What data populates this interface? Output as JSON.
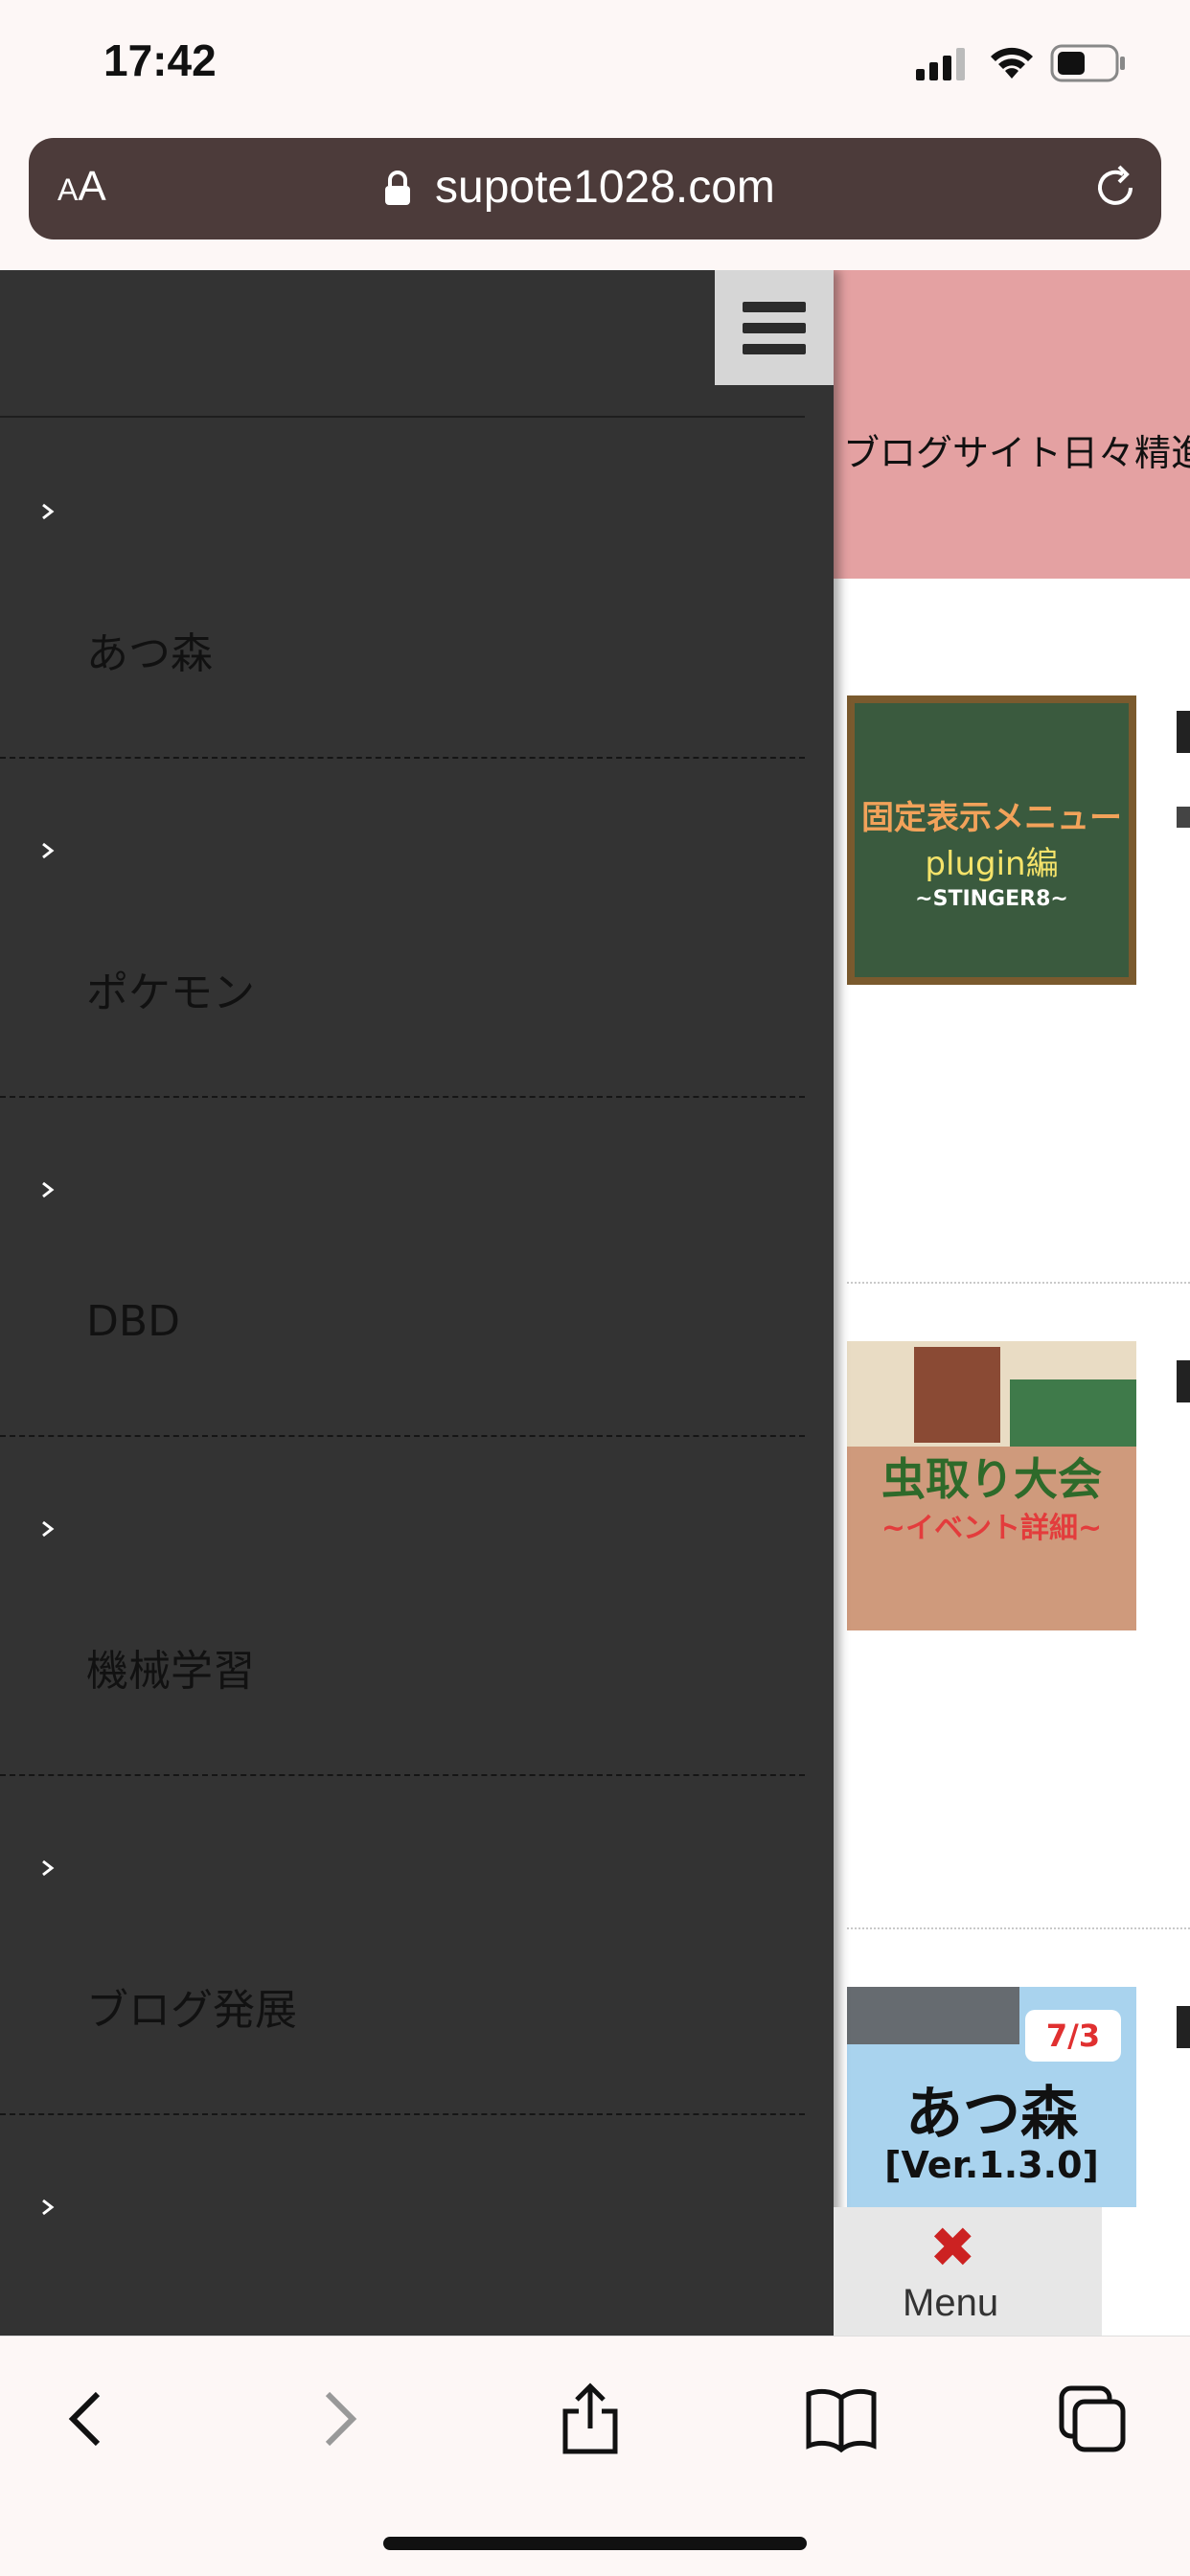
{
  "status_bar": {
    "time": "17:42"
  },
  "url_bar": {
    "aa_small": "A",
    "aa_large": "A",
    "url": "supote1028.com"
  },
  "drawer": {
    "items": [
      {
        "label": "あつ森"
      },
      {
        "label": "ポケモン"
      },
      {
        "label": "DBD"
      },
      {
        "label": "機械学習"
      },
      {
        "label": "ブログ発展"
      },
      {
        "label": ""
      }
    ]
  },
  "page": {
    "tagline": "ブログサイト日々精進",
    "posts": [
      {
        "thumb_line1": "固定表示メニュー",
        "thumb_line2": "plugin編",
        "thumb_line3": "~STINGER8~"
      },
      {
        "thumb_line1": "虫取り大会",
        "thumb_line2": "~イベント詳細~"
      },
      {
        "thumb_badge": "7/3",
        "thumb_line1": "あつ森",
        "thumb_line2": "[Ver.1.3.0]"
      }
    ]
  },
  "menu_tab": {
    "label": "Menu"
  },
  "colors": {
    "drawer_bg": "#333333",
    "banner_bg": "#e4a1a2",
    "url_bar_bg": "#4c3b3a",
    "close_x": "#cc2222"
  }
}
